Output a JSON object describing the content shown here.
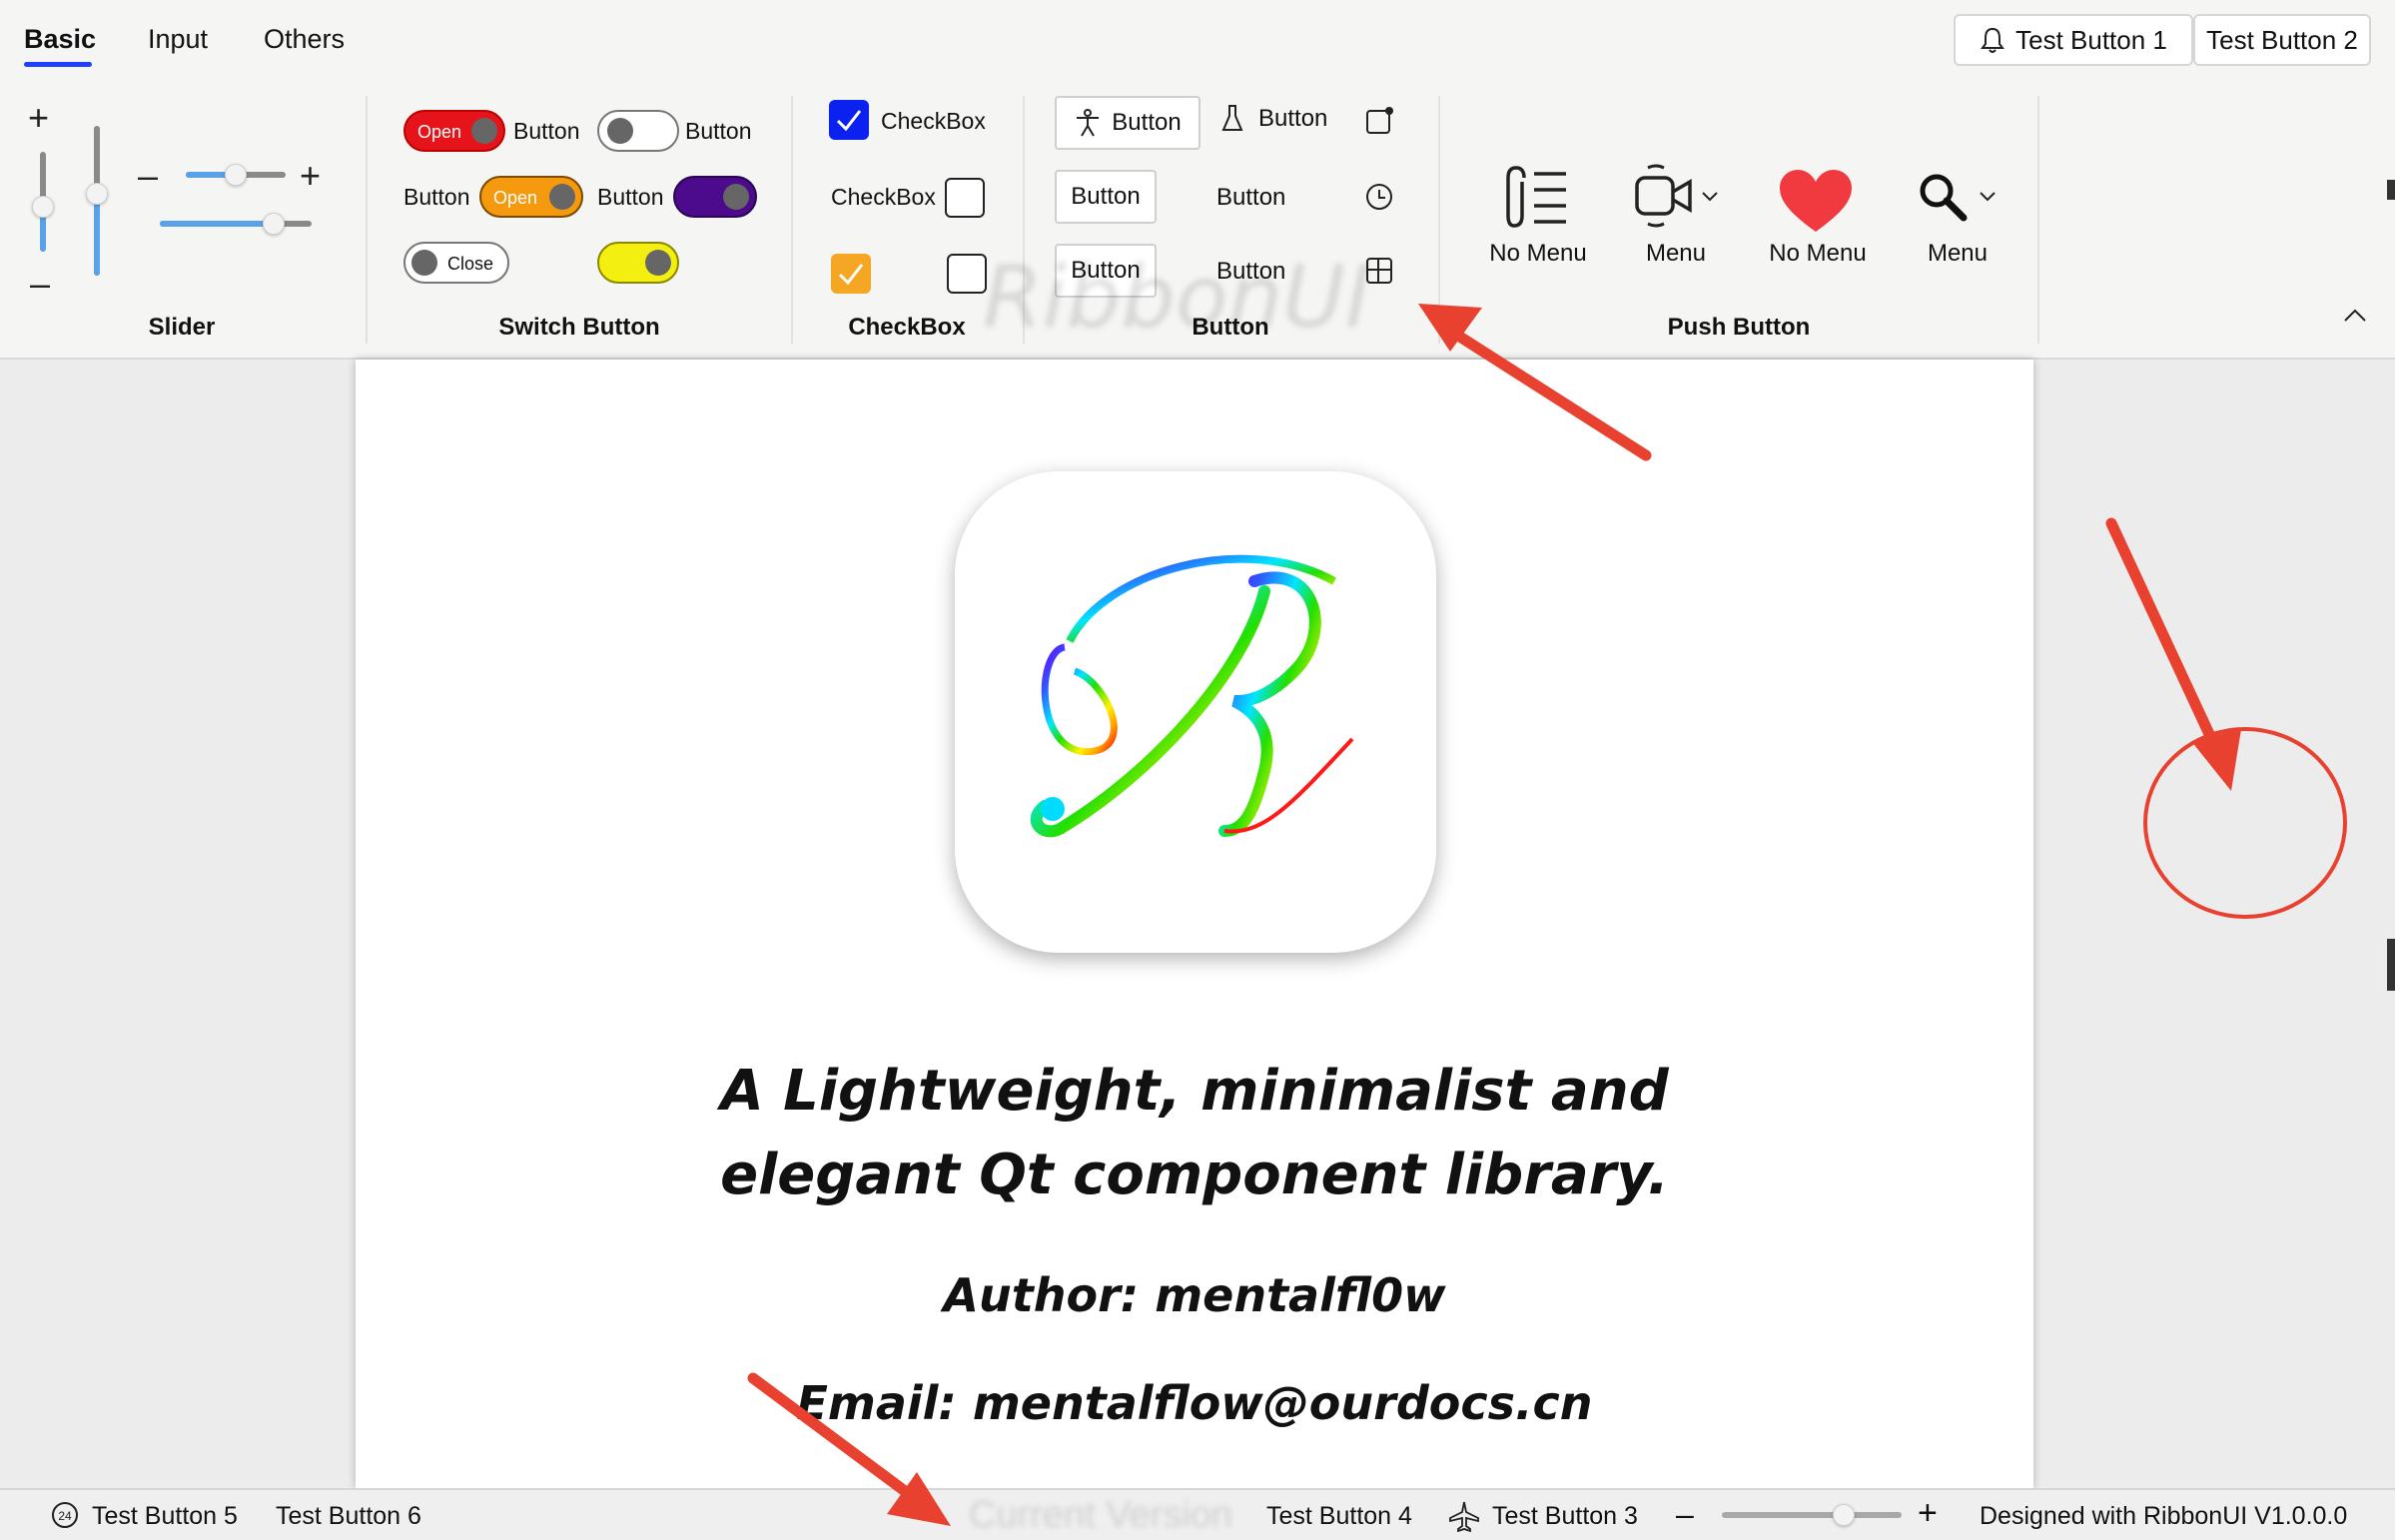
{
  "tabs": [
    {
      "label": "Basic",
      "active": true
    },
    {
      "label": "Input",
      "active": false
    },
    {
      "label": "Others",
      "active": false
    }
  ],
  "top_buttons": {
    "button1": {
      "label": "Test Button 1",
      "icon": "bell-icon"
    },
    "button2": {
      "label": "Test Button 2"
    }
  },
  "groups": {
    "slider": {
      "label": "Slider",
      "values": {
        "vertical_left": 0.45,
        "vertical_right": 0.55,
        "horizontal_top": 0.5,
        "horizontal_bottom": 0.75
      }
    },
    "switch": {
      "label": "Switch Button",
      "items": [
        {
          "text": "Open",
          "on": true,
          "color": "#e6131b",
          "label": "Button"
        },
        {
          "on": false,
          "color": "#ffffff",
          "label": "Button"
        },
        {
          "label": "Button",
          "text": "Open",
          "on": true,
          "color": "#f59a0f"
        },
        {
          "label": "Button",
          "on": true,
          "color": "#4b0b8c"
        },
        {
          "text": "Close",
          "on": false,
          "color": "#ffffff"
        },
        {
          "on": true,
          "color": "#f3ef10"
        }
      ]
    },
    "checkbox": {
      "label": "CheckBox",
      "items": [
        {
          "label": "CheckBox",
          "checked": true,
          "color": "#0b21f0"
        },
        {
          "label": "CheckBox",
          "checked": false
        },
        {
          "checked": true,
          "color": "#f5a623"
        },
        {
          "checked": false
        }
      ]
    },
    "button": {
      "label": "Button",
      "items": [
        {
          "label": "Button",
          "icon": "accessibility-icon"
        },
        {
          "label": "Button",
          "icon": "flask-icon"
        },
        {
          "icon": "square-dot-icon"
        },
        {
          "label": "Button"
        },
        {
          "label": "Button"
        },
        {
          "icon": "clock-icon"
        },
        {
          "label": "Button"
        },
        {
          "label": "Button"
        },
        {
          "icon": "layout-icon"
        }
      ]
    },
    "push": {
      "label": "Push Button",
      "items": [
        {
          "label": "No Menu",
          "icon": "paperclip-list-icon"
        },
        {
          "label": "Menu",
          "icon": "video-camera-icon"
        },
        {
          "label": "No Menu",
          "icon": "heart-icon",
          "color": "#f03a3f"
        },
        {
          "label": "Menu",
          "icon": "search-icon"
        }
      ]
    }
  },
  "watermark": "RibbonUI",
  "document": {
    "tagline_line1": "A Lightweight, minimalist and",
    "tagline_line2": "elegant Qt component library.",
    "author": "Author: mentalfl0w",
    "email": "Email: mentalflow@ourdocs.cn"
  },
  "statusbar": {
    "left": [
      {
        "label": "Test Button 5",
        "icon": "24-badge-icon"
      },
      {
        "label": "Test Button 6"
      }
    ],
    "center_ghost": "Current Version",
    "right": [
      {
        "label": "Test Button 4"
      },
      {
        "label": "Test Button 3",
        "icon": "airplane-icon"
      }
    ],
    "zoom": 0.68,
    "credit": "Designed with RibbonUI V1.0.0.0"
  },
  "colors": {
    "annotation": "#e8412f",
    "accent": "#1e40ff",
    "slider": "#5aa2e8"
  }
}
